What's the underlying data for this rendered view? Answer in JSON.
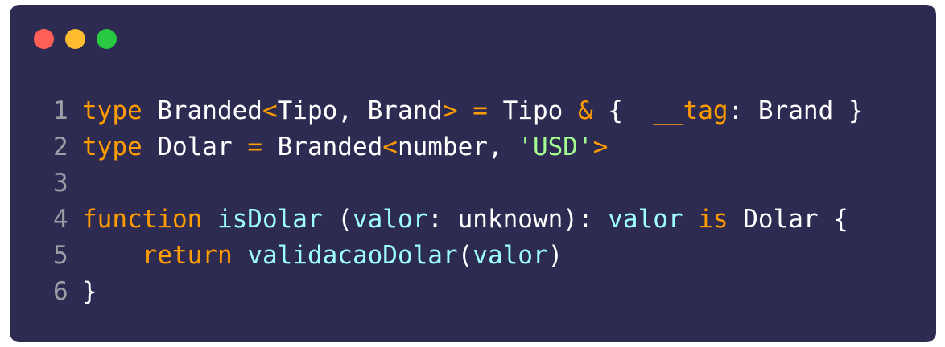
{
  "window": {
    "controls": [
      "close",
      "minimize",
      "maximize"
    ],
    "colors": {
      "background": "#2e2b52",
      "close": "#ff5f57",
      "minimize": "#febc2e",
      "maximize": "#28c840"
    }
  },
  "code": {
    "language": "typescript",
    "colors": {
      "keyword": "#ff9d00",
      "identifier": "#9effff",
      "string": "#a5ff90",
      "text": "#ffffff",
      "line_number": "#9aa0a6"
    },
    "lines": [
      {
        "number": "1",
        "tokens": [
          {
            "t": "type",
            "c": "kw"
          },
          {
            "t": " Branded",
            "c": "plain"
          },
          {
            "t": "<",
            "c": "kw"
          },
          {
            "t": "Tipo, Brand",
            "c": "plain"
          },
          {
            "t": ">",
            "c": "kw"
          },
          {
            "t": " ",
            "c": "plain"
          },
          {
            "t": "=",
            "c": "kw"
          },
          {
            "t": " Tipo ",
            "c": "plain"
          },
          {
            "t": "&",
            "c": "kw"
          },
          {
            "t": " {  ",
            "c": "plain"
          },
          {
            "t": "__tag",
            "c": "kw"
          },
          {
            "t": ": Brand }",
            "c": "plain"
          }
        ]
      },
      {
        "number": "2",
        "tokens": [
          {
            "t": "type",
            "c": "kw"
          },
          {
            "t": " Dolar ",
            "c": "plain"
          },
          {
            "t": "=",
            "c": "kw"
          },
          {
            "t": " Branded",
            "c": "plain"
          },
          {
            "t": "<",
            "c": "kw"
          },
          {
            "t": "number, ",
            "c": "plain"
          },
          {
            "t": "'USD'",
            "c": "str"
          },
          {
            "t": ">",
            "c": "kw"
          }
        ]
      },
      {
        "number": "3",
        "tokens": []
      },
      {
        "number": "4",
        "tokens": [
          {
            "t": "function",
            "c": "kw"
          },
          {
            "t": " ",
            "c": "plain"
          },
          {
            "t": "isDolar",
            "c": "fn"
          },
          {
            "t": " (",
            "c": "plain"
          },
          {
            "t": "valor",
            "c": "fn"
          },
          {
            "t": ": unknown): ",
            "c": "plain"
          },
          {
            "t": "valor",
            "c": "fn"
          },
          {
            "t": " ",
            "c": "plain"
          },
          {
            "t": "is",
            "c": "kw"
          },
          {
            "t": " Dolar {",
            "c": "plain"
          }
        ]
      },
      {
        "number": "5",
        "tokens": [
          {
            "t": "    ",
            "c": "plain"
          },
          {
            "t": "return",
            "c": "kw"
          },
          {
            "t": " ",
            "c": "plain"
          },
          {
            "t": "validacaoDolar",
            "c": "fn"
          },
          {
            "t": "(",
            "c": "plain"
          },
          {
            "t": "valor",
            "c": "fn"
          },
          {
            "t": ")",
            "c": "plain"
          }
        ]
      },
      {
        "number": "6",
        "tokens": [
          {
            "t": "}",
            "c": "plain"
          }
        ]
      }
    ]
  }
}
